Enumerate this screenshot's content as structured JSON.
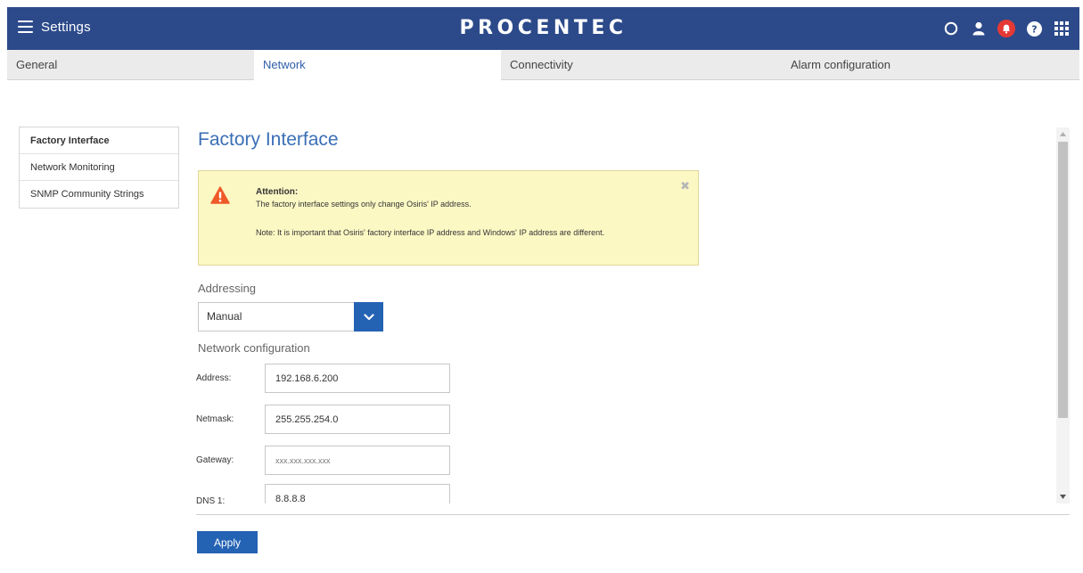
{
  "header": {
    "app_title": "Settings",
    "brand": "PROCENTEC",
    "icons": [
      "circle-icon",
      "user-icon",
      "bell-icon",
      "help-icon",
      "apps-grid-icon"
    ],
    "accent_color": "#2c4a8a",
    "alert_color": "#e53935"
  },
  "tabs": [
    {
      "label": "General",
      "active": false
    },
    {
      "label": "Network",
      "active": true
    },
    {
      "label": "Connectivity",
      "active": false
    },
    {
      "label": "Alarm configuration",
      "active": false
    }
  ],
  "sidebar": {
    "items": [
      {
        "label": "Factory Interface",
        "active": true
      },
      {
        "label": "Network Monitoring",
        "active": false
      },
      {
        "label": "SNMP Community Strings",
        "active": false
      }
    ]
  },
  "main": {
    "title": "Factory Interface",
    "alert": {
      "heading": "Attention:",
      "line1": "The factory interface settings only change Osiris' IP address.",
      "line2": "Note: It is important that Osiris' factory interface IP address and Windows' IP address are different.",
      "color": "#fcf8c4"
    },
    "addressing": {
      "label": "Addressing",
      "selected": "Manual"
    },
    "network_config": {
      "label": "Network configuration",
      "fields": [
        {
          "label": "Address:",
          "value": "192.168.6.200",
          "placeholder": ""
        },
        {
          "label": "Netmask:",
          "value": "255.255.254.0",
          "placeholder": ""
        },
        {
          "label": "Gateway:",
          "value": "",
          "placeholder": "xxx.xxx.xxx.xxx"
        },
        {
          "label": "DNS 1:",
          "value": "8.8.8.8",
          "placeholder": ""
        }
      ]
    },
    "apply_label": "Apply",
    "button_color": "#2462b4"
  }
}
